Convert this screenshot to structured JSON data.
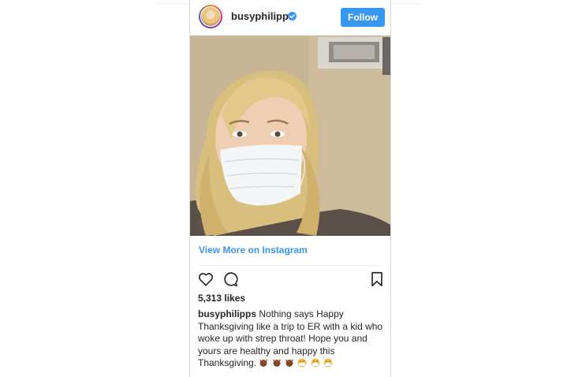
{
  "post": {
    "username": "busyphilipps",
    "follow_label": "Follow",
    "view_more_label": "View More on Instagram",
    "likes": "5,313 likes",
    "caption_user": "busyphilipps",
    "caption_text": "Nothing says Happy Thanksgiving like a trip to ER with a kid who woke up with strep throat! Hope you and yours are healthy and happy this Thanksgiving.",
    "caption_emojis": [
      "turkey-emoji",
      "turkey-emoji",
      "turkey-emoji",
      "mask-face-emoji",
      "mask-face-emoji",
      "mask-face-emoji"
    ]
  },
  "icons": {
    "verified": "verified-badge-icon",
    "like": "heart-icon",
    "comment": "comment-icon",
    "save": "bookmark-icon"
  },
  "colors": {
    "accent": "#3897f0",
    "text": "#262626",
    "border": "#dbdbdb"
  }
}
